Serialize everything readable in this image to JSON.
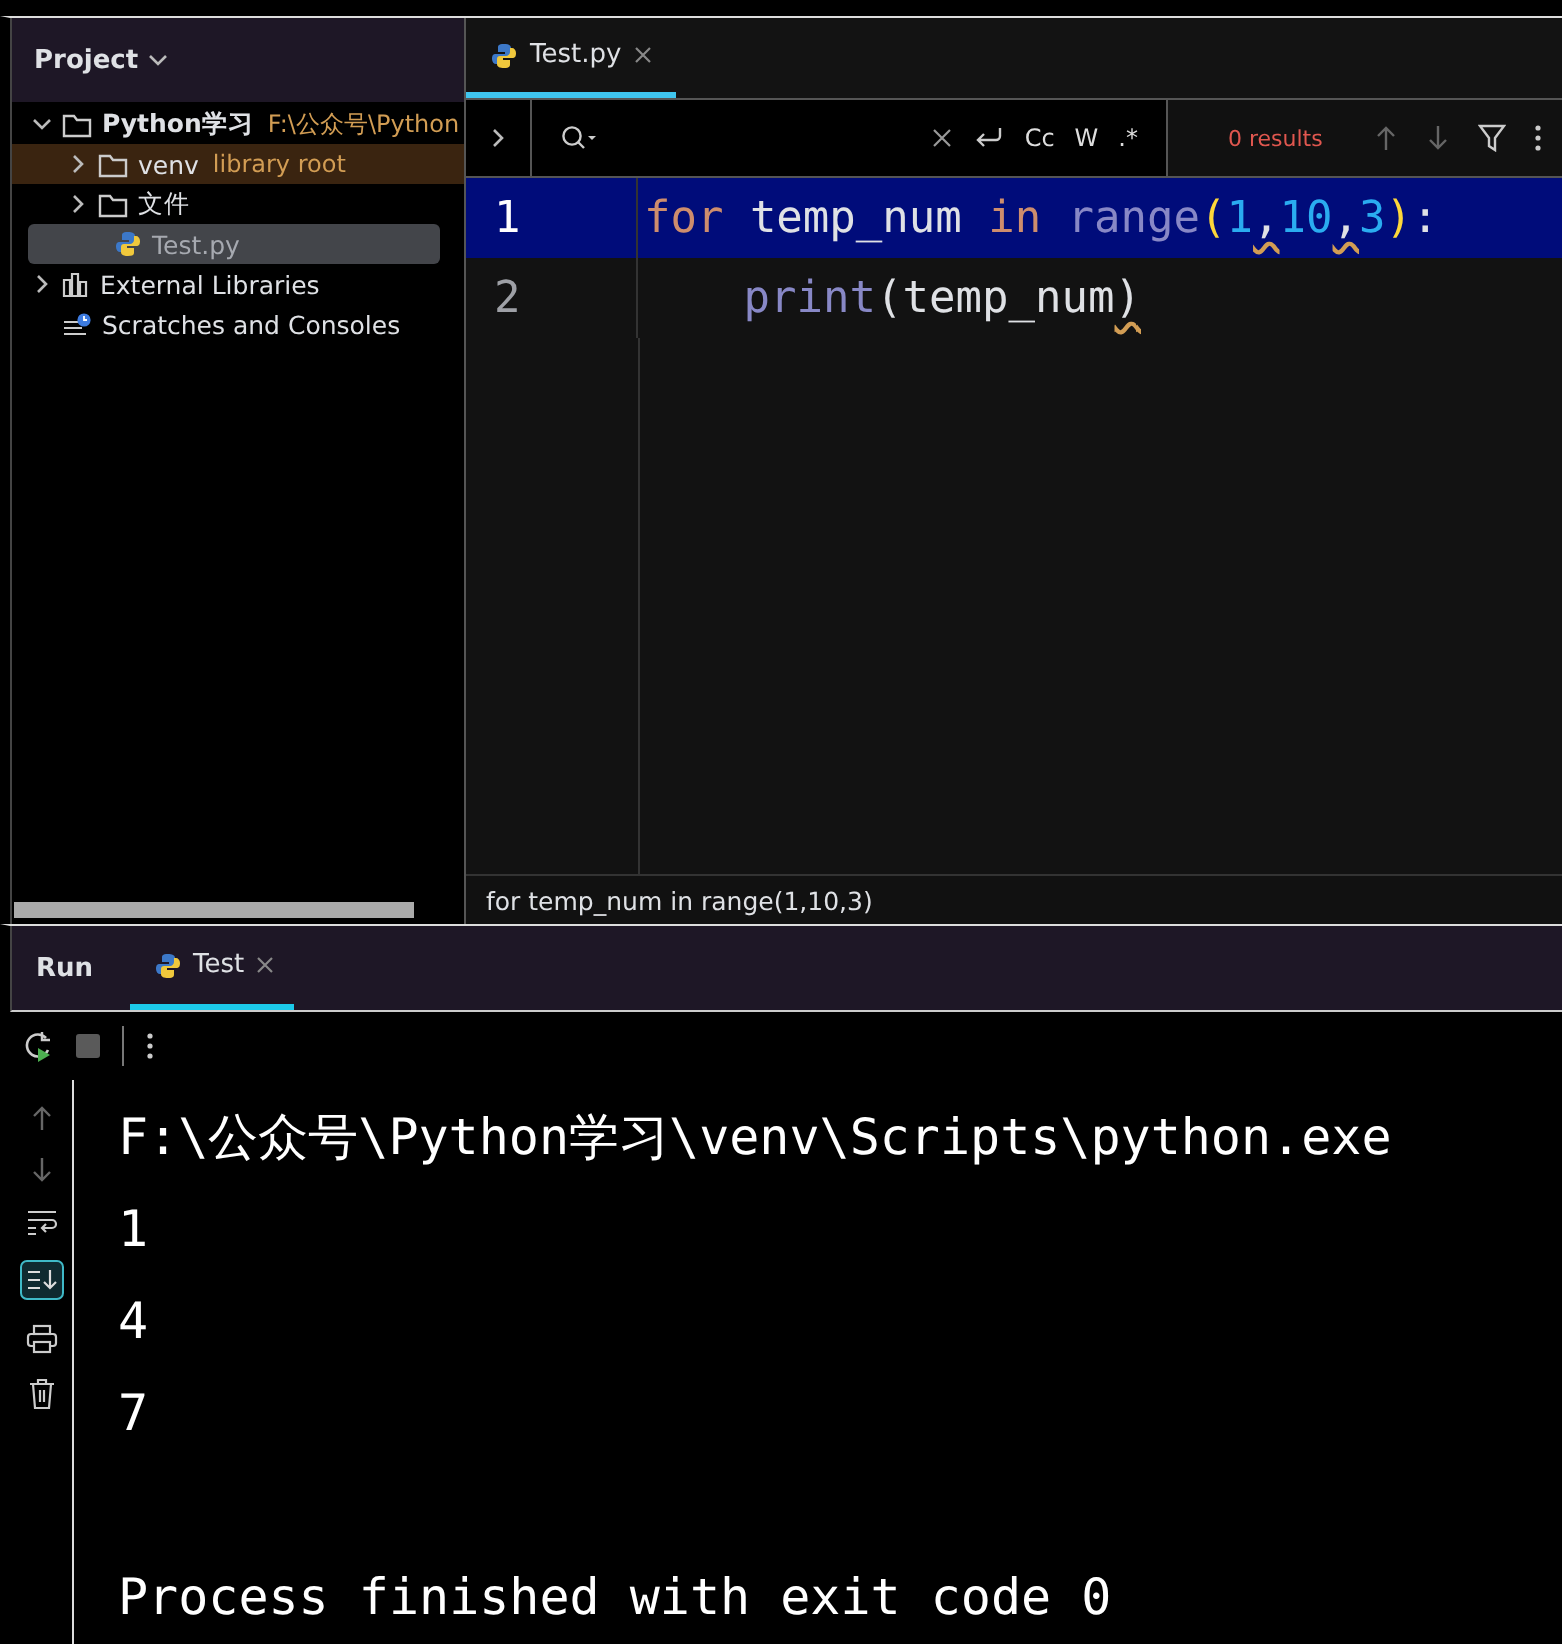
{
  "project_panel": {
    "title": "Project",
    "tree": [
      {
        "label": "Python学习",
        "hint": "F:\\公众号\\Python",
        "kind": "folder",
        "expanded": true,
        "selected": false,
        "excluded": false,
        "children": [
          {
            "label": "venv",
            "hint": "library root",
            "kind": "folder",
            "expanded": false,
            "selected": false,
            "excluded": true
          },
          {
            "label": "文件",
            "kind": "folder",
            "expanded": false,
            "selected": false,
            "excluded": false
          },
          {
            "label": "Test.py",
            "kind": "python",
            "selected": true,
            "excluded": false
          }
        ]
      },
      {
        "label": "External Libraries",
        "kind": "libraries",
        "expanded": false,
        "selected": false,
        "excluded": false
      },
      {
        "label": "Scratches and Consoles",
        "kind": "scratches",
        "selected": false,
        "excluded": false
      }
    ]
  },
  "editor": {
    "tabs": [
      {
        "label": "Test.py",
        "selected": true
      }
    ],
    "search": {
      "results": "0 results",
      "buttons": [
        "Cc",
        "W",
        ".*"
      ]
    },
    "lines": [
      {
        "number": "1",
        "current": true,
        "indented": false,
        "tokens": [
          {
            "text": "for",
            "kind": "keyword"
          },
          {
            "text": "temp_num",
            "kind": "ident",
            "spaced": true
          },
          {
            "text": "in",
            "kind": "keyword",
            "spaced": true
          },
          {
            "text": "range",
            "kind": "builtin",
            "spaced": true
          },
          {
            "text": "(",
            "kind": "paren"
          },
          {
            "text": "1",
            "kind": "number"
          },
          {
            "text": ",",
            "kind": "punct",
            "warning": true
          },
          {
            "text": "10",
            "kind": "number"
          },
          {
            "text": ",",
            "kind": "punct",
            "warning": true
          },
          {
            "text": "3",
            "kind": "number"
          },
          {
            "text": ")",
            "kind": "paren"
          },
          {
            "text": ":",
            "kind": "punct"
          }
        ]
      },
      {
        "number": "2",
        "current": false,
        "indented": true,
        "tokens": [
          {
            "text": "print",
            "kind": "builtin"
          },
          {
            "text": "(temp_num",
            "kind": "ident"
          },
          {
            "text": ")",
            "kind": "ident",
            "warning": true
          }
        ]
      }
    ],
    "breadcrumb": "for temp_num in range(1,10,3)"
  },
  "run_panel": {
    "title": "Run",
    "tabs": [
      {
        "label": "Test",
        "selected": true
      }
    ],
    "output_blocks": [
      [
        "F:\\公众号\\Python学习\\venv\\Scripts\\python.exe",
        "1",
        "4",
        "7"
      ],
      [
        "Process finished with exit code 0"
      ]
    ]
  }
}
